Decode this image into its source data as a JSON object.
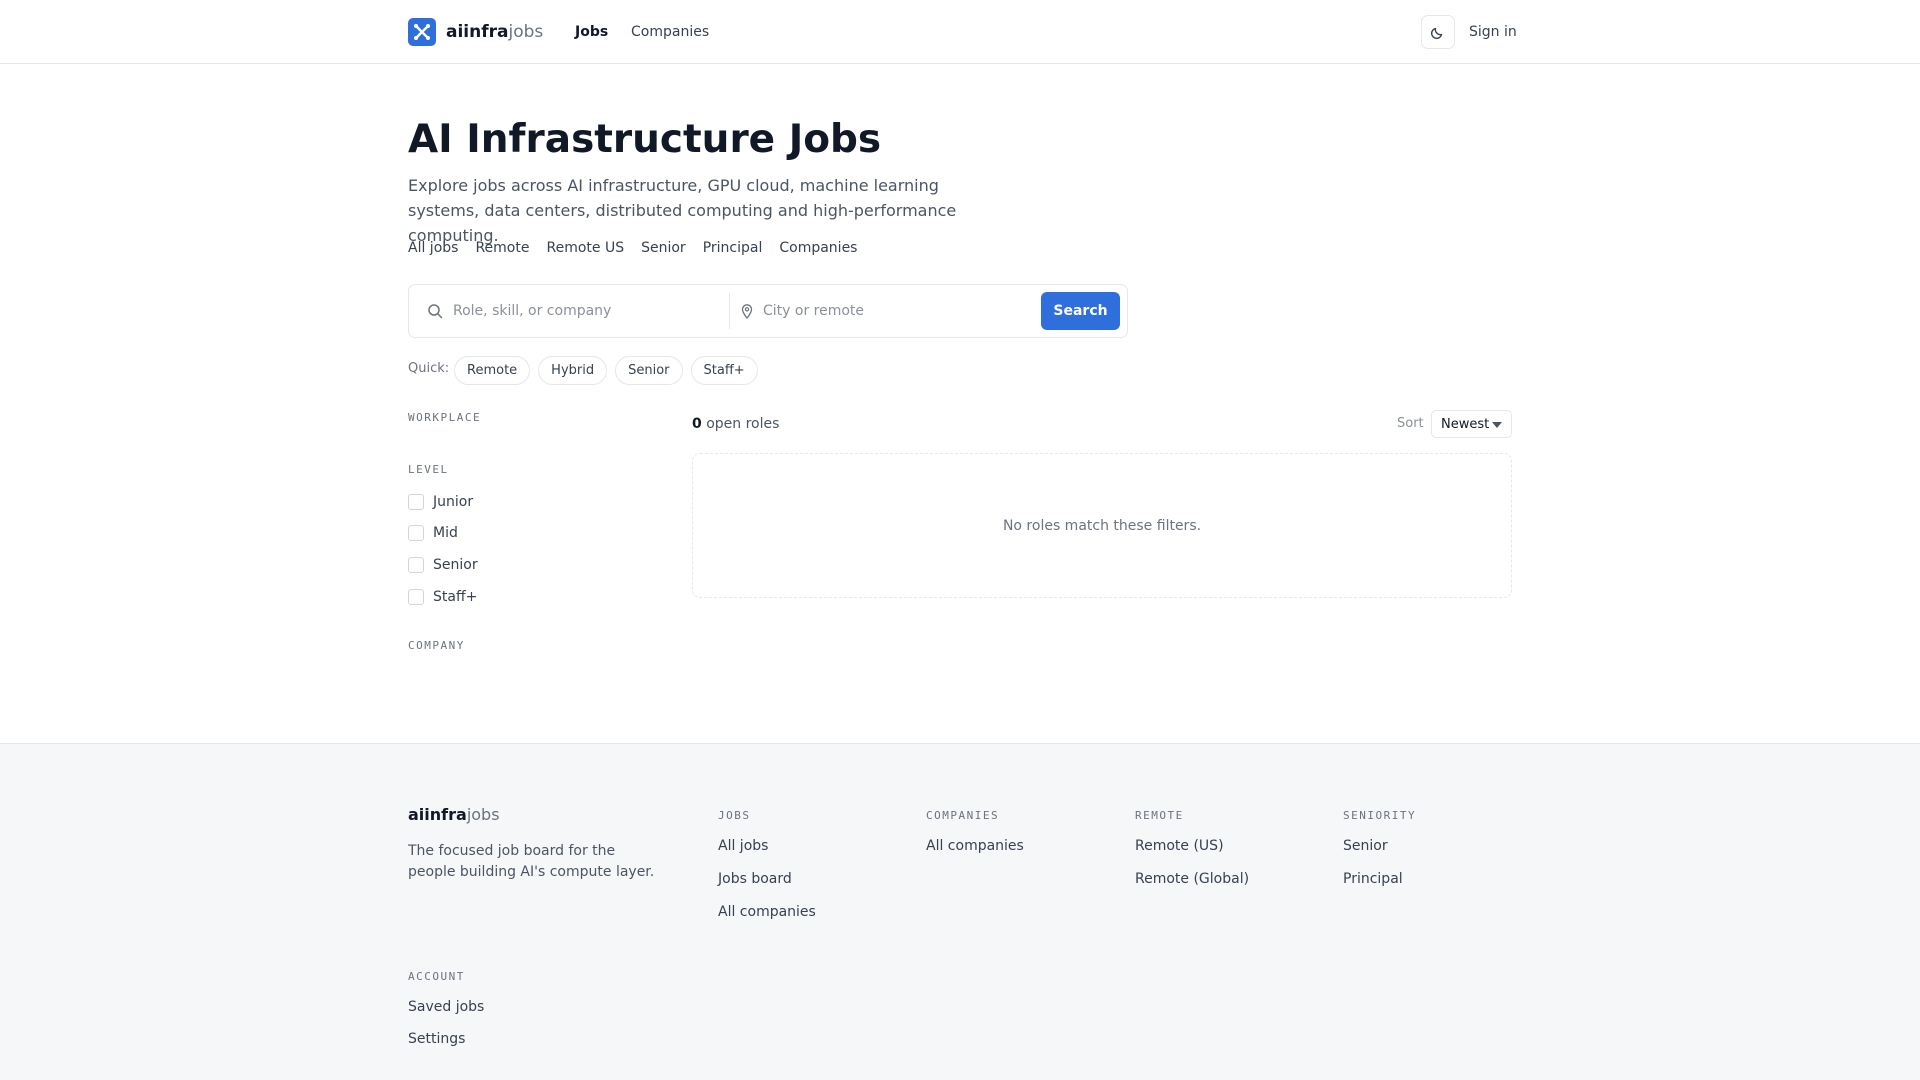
{
  "brand": {
    "bold": "aiinfra",
    "light": "jobs"
  },
  "nav": {
    "jobs": "Jobs",
    "companies": "Companies",
    "signin": "Sign in"
  },
  "hero": {
    "title": "AI Infrastructure Jobs",
    "subtitle": "Explore jobs across AI infrastructure, GPU cloud, machine learning systems, data centers, distributed computing and high-performance computing.",
    "links": [
      "All jobs",
      "Remote",
      "Remote US",
      "Senior",
      "Principal",
      "Companies"
    ]
  },
  "search": {
    "role_placeholder": "Role, skill, or company",
    "location_placeholder": "City or remote",
    "button": "Search"
  },
  "quick": {
    "label": "Quick:",
    "chips": [
      "Remote",
      "Hybrid",
      "Senior",
      "Staff+"
    ]
  },
  "filters": {
    "workplace": "WORKPLACE",
    "level": "LEVEL",
    "levels": [
      "Junior",
      "Mid",
      "Senior",
      "Staff+"
    ],
    "company": "COMPANY"
  },
  "results": {
    "count": "0",
    "count_label": " open roles",
    "sort_label": "Sort",
    "sort_value": "Newest",
    "empty": "No roles match these filters."
  },
  "footer": {
    "tagline": "The focused job board for the people building AI's compute layer.",
    "jobs_head": "JOBS",
    "jobs_links": [
      "All jobs",
      "Jobs board",
      "All companies"
    ],
    "companies_head": "COMPANIES",
    "companies_links": [
      "All companies"
    ],
    "remote_head": "REMOTE",
    "remote_links": [
      "Remote (US)",
      "Remote (Global)"
    ],
    "seniority_head": "SENIORITY",
    "seniority_links": [
      "Senior",
      "Principal"
    ],
    "account_head": "ACCOUNT",
    "account_links": [
      "Saved jobs",
      "Settings"
    ]
  },
  "colors": {
    "accent": "#2f6fdb",
    "border": "#e5e7eb",
    "footer_bg": "#f6f7f9"
  }
}
